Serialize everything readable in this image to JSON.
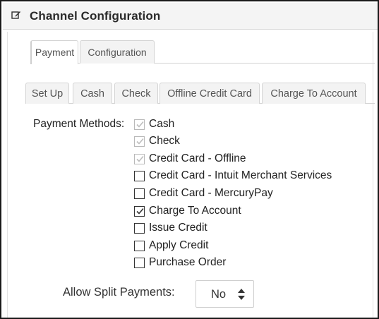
{
  "header": {
    "title": "Channel Configuration",
    "icon": "edit-icon"
  },
  "top_tabs": [
    {
      "label": "Payment",
      "active": true
    },
    {
      "label": "Configuration",
      "active": false
    }
  ],
  "sub_tabs": [
    {
      "label": "Set Up"
    },
    {
      "label": "Cash"
    },
    {
      "label": "Check"
    },
    {
      "label": "Offline Credit Card"
    },
    {
      "label": "Charge To Account"
    }
  ],
  "payment_methods": {
    "label": "Payment Methods:",
    "options": [
      {
        "label": "Cash",
        "checked": true,
        "disabled": true
      },
      {
        "label": "Check",
        "checked": true,
        "disabled": true
      },
      {
        "label": "Credit Card - Offline",
        "checked": true,
        "disabled": true
      },
      {
        "label": "Credit Card - Intuit Merchant Services",
        "checked": false,
        "disabled": false
      },
      {
        "label": "Credit Card - MercuryPay",
        "checked": false,
        "disabled": false
      },
      {
        "label": "Charge To Account",
        "checked": true,
        "disabled": false
      },
      {
        "label": "Issue Credit",
        "checked": false,
        "disabled": false
      },
      {
        "label": "Apply Credit",
        "checked": false,
        "disabled": false
      },
      {
        "label": "Purchase Order",
        "checked": false,
        "disabled": false
      }
    ]
  },
  "split_payments": {
    "label": "Allow Split Payments:",
    "value": "No"
  },
  "colors": {
    "check_enabled": "#333333",
    "check_disabled": "#bdbdbd",
    "header_bg": "#f4f4f4"
  }
}
